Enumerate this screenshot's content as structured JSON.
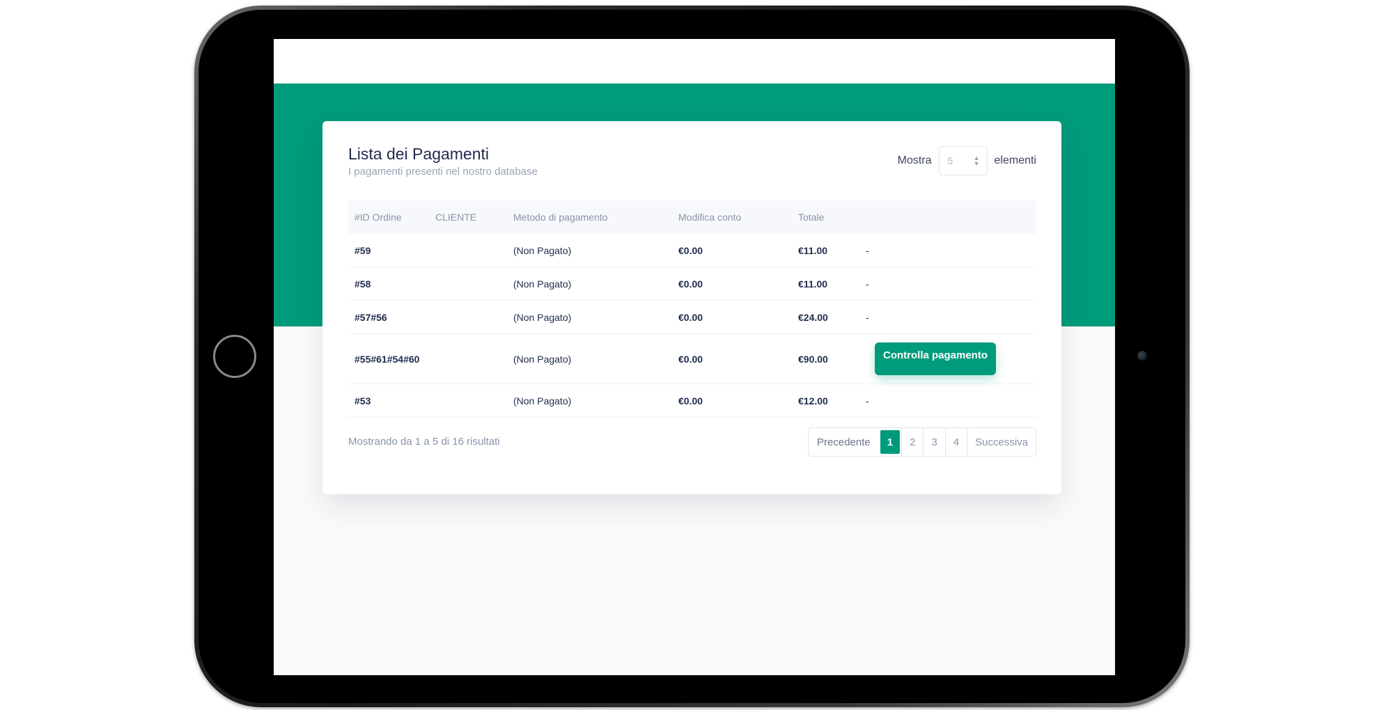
{
  "card": {
    "title": "Lista dei Pagamenti",
    "subtitle": "I pagamenti presenti nel nostro database"
  },
  "show": {
    "prefix": "Mostra",
    "value": "5",
    "suffix": "elementi"
  },
  "table": {
    "headers": [
      "#ID Ordine",
      "CLIENTE",
      "Metodo di pagamento",
      "Modifica conto",
      "Totale",
      ""
    ],
    "rows": [
      {
        "id": "#59",
        "cliente": "",
        "metodo": "(Non Pagato)",
        "modifica": "€0.00",
        "totale": "€11.00",
        "action": "-"
      },
      {
        "id": "#58",
        "cliente": "",
        "metodo": "(Non Pagato)",
        "modifica": "€0.00",
        "totale": "€11.00",
        "action": "-"
      },
      {
        "id": "#57#56",
        "cliente": "",
        "metodo": "(Non Pagato)",
        "modifica": "€0.00",
        "totale": "€24.00",
        "action": "-"
      },
      {
        "id": "#55#61#54#60",
        "cliente": "",
        "metodo": "(Non Pagato)",
        "modifica": "€0.00",
        "totale": "€90.00",
        "action": "Controlla pagamento"
      },
      {
        "id": "#53",
        "cliente": "",
        "metodo": "(Non Pagato)",
        "modifica": "€0.00",
        "totale": "€12.00",
        "action": "-"
      }
    ]
  },
  "footer": {
    "info": "Mostrando da 1 a 5 di 16 risultati",
    "prev": "Precedente",
    "pages": [
      "1",
      "2",
      "3",
      "4"
    ],
    "active_page": "1",
    "next": "Successiva"
  },
  "colors": {
    "accent": "#009b7b",
    "title": "#1f2b4d",
    "muted": "#8893aa"
  }
}
